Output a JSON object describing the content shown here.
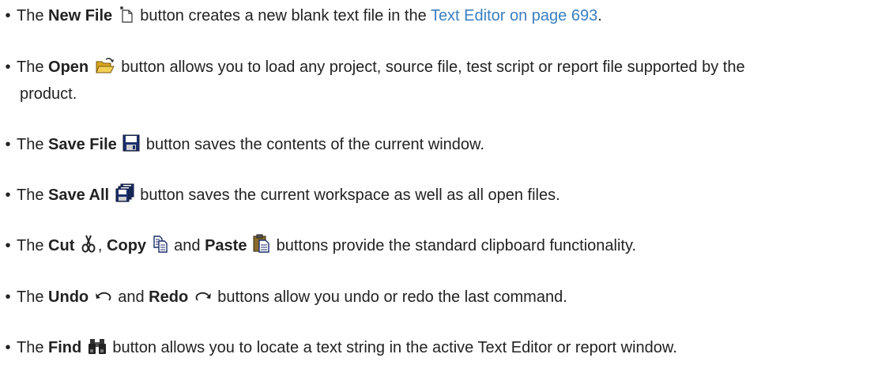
{
  "bullet": "•",
  "items": {
    "new_file": {
      "pre": "The ",
      "name": "New File",
      "post": " button creates a new blank text file in the ",
      "link": "Text Editor on page 693",
      "end": ".",
      "icon": "new-file-icon"
    },
    "open": {
      "pre": "The ",
      "name": "Open",
      "post": " button allows you to load any project, source file, test script or report file supported by the",
      "post2": "product.",
      "icon": "open-folder-icon"
    },
    "save_file": {
      "pre": "The ",
      "name": "Save File",
      "post": " button saves the contents of the current window.",
      "icon": "floppy-disk-icon"
    },
    "save_all": {
      "pre": "The ",
      "name": "Save All",
      "post": " button saves the current workspace as well as all open files.",
      "icon": "save-all-icon"
    },
    "clipboard": {
      "pre": "The ",
      "cut": "Cut",
      "sep": ", ",
      "copy": "Copy",
      "and": " and ",
      "paste": "Paste",
      "post": " buttons provide the standard clipboard functionality.",
      "icons": [
        "scissors-icon",
        "copy-icon",
        "paste-icon"
      ]
    },
    "undo_redo": {
      "pre": "The ",
      "undo": "Undo",
      "and": " and ",
      "redo": "Redo",
      "post": " buttons allow you undo or redo the last command.",
      "icons": [
        "undo-icon",
        "redo-icon"
      ]
    },
    "find": {
      "pre": "The ",
      "name": "Find",
      "post": " button allows you to locate a text string in the active Text Editor or report window.",
      "icon": "binoculars-icon"
    }
  }
}
